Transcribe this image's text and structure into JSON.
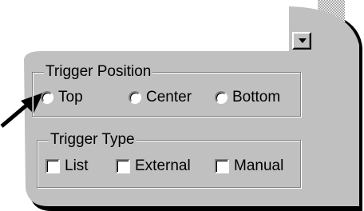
{
  "colors": {
    "panel": "#c0c0c0",
    "pointer_arrow": "#000000"
  },
  "dropdown": {
    "icon": "chevron-down-icon"
  },
  "trigger_position": {
    "label": "Trigger Position",
    "options": [
      {
        "label": "Top",
        "selected": false
      },
      {
        "label": "Center",
        "selected": false
      },
      {
        "label": "Bottom",
        "selected": false
      }
    ]
  },
  "trigger_type": {
    "label": "Trigger Type",
    "options": [
      {
        "label": "List",
        "checked": false
      },
      {
        "label": "External",
        "checked": false
      },
      {
        "label": "Manual",
        "checked": false
      }
    ]
  }
}
